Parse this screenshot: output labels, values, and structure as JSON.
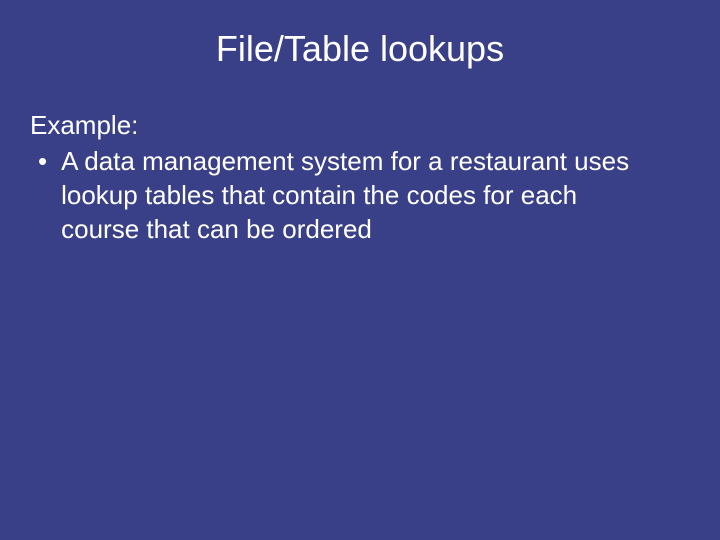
{
  "slide": {
    "title": "File/Table lookups",
    "example_label": "Example:",
    "bullet_marker": "•",
    "bullet_text": "A data management system for a restaurant uses lookup tables that contain the codes for each course that can be ordered"
  }
}
